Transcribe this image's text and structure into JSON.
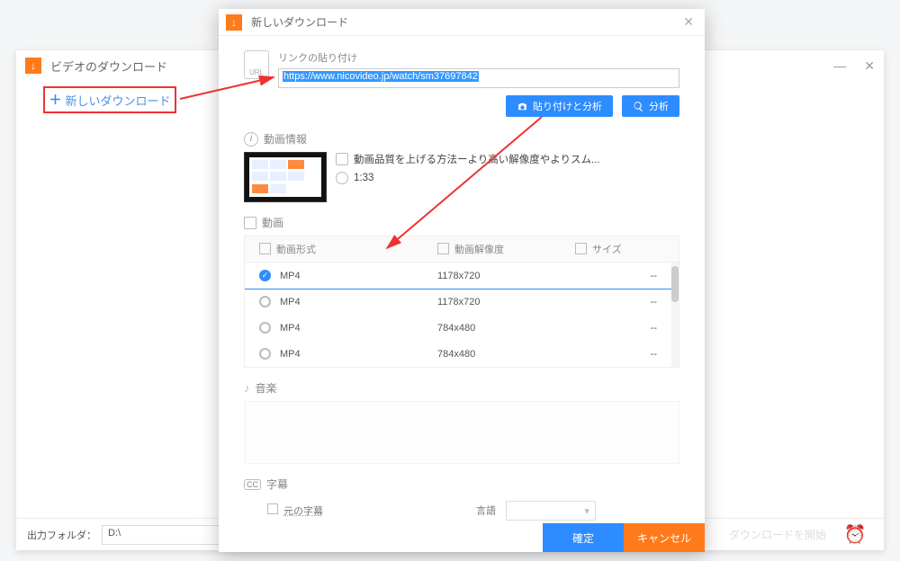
{
  "bgwin": {
    "title": "ビデオのダウンロード",
    "new_download": "新しいダウンロード",
    "min": "—",
    "close": "✕"
  },
  "footer": {
    "output_folder_label": "出力フォルダ：",
    "output_folder_value": "D:\\",
    "ghost_button": "ダウンロードを開始"
  },
  "dialog": {
    "title": "新しいダウンロード",
    "paste_label": "リンクの貼り付け",
    "url_value": "https://www.nicovideo.jp/watch/sm37697842",
    "btn_paste_analyze": "貼り付けと分析",
    "btn_analyze": "分析",
    "video_info_label": "動画情報",
    "video_title": "動画品質を上げる方法ーより高い解像度やよりスム...",
    "video_duration": "1:33",
    "video_section_label": "動画",
    "table": {
      "col_format": "動画形式",
      "col_resolution": "動画解像度",
      "col_size": "サイズ",
      "rows": [
        {
          "format": "MP4",
          "resolution": "1178x720",
          "size": "--",
          "selected": true
        },
        {
          "format": "MP4",
          "resolution": "1178x720",
          "size": "--",
          "selected": false
        },
        {
          "format": "MP4",
          "resolution": "784x480",
          "size": "--",
          "selected": false
        },
        {
          "format": "MP4",
          "resolution": "784x480",
          "size": "--",
          "selected": false
        }
      ]
    },
    "music_label": "音楽",
    "subtitle_label": "字幕",
    "original_subtitle": "元の字幕",
    "language_label": "言語",
    "ok": "確定",
    "cancel": "キャンセル"
  }
}
